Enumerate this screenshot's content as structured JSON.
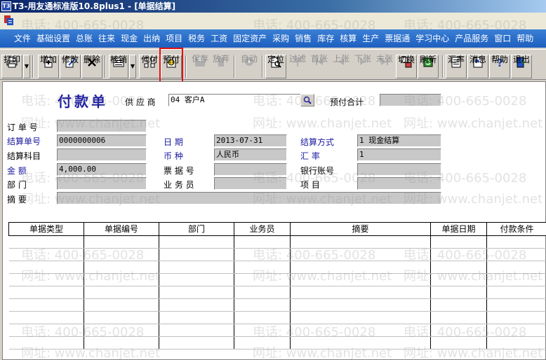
{
  "window": {
    "title": "T3-用友通标准版10.8plus1 - [单据结算]",
    "app_icon": "T3"
  },
  "menu": [
    "文件",
    "基础设置",
    "总账",
    "往来",
    "现金",
    "出纳",
    "项目",
    "税务",
    "工资",
    "固定资产",
    "采购",
    "销售",
    "库存",
    "核算",
    "生产",
    "票据通",
    "学习中心",
    "产品服务",
    "窗口",
    "帮助"
  ],
  "toolbar": {
    "print": "打印",
    "add": "增加",
    "modify": "修改",
    "delete": "删除",
    "writeoff": "核销",
    "proxy_pay": "代付",
    "prepay": "预付",
    "save": "保存",
    "abandon": "放弃",
    "auto": "自动",
    "locate": "定位",
    "filter": "过滤",
    "first": "首张",
    "prev": "上张",
    "next": "下张",
    "last": "末张",
    "switch": "切换",
    "refresh": "刷新",
    "exchange_rate": "汇率",
    "message": "消息",
    "help": "帮助",
    "exit": "退出"
  },
  "form": {
    "title": "付款单",
    "supplier_label": "供 应 商",
    "supplier_value": "04  客户A",
    "prepay_total_label": "预付合计",
    "prepay_total_value": "",
    "order_no_label": "订 单 号",
    "order_no_value": "",
    "settle_no_label": "结算单号",
    "settle_no_value": "0000000006",
    "date_label": "日    期",
    "date_value": "2013-07-31",
    "settle_method_label": "结算方式",
    "settle_method_value": "1  现金结算",
    "settle_subject_label": "结算科目",
    "settle_subject_value": "",
    "currency_label": "币    种",
    "currency_value": "人民币",
    "rate_label": "汇    率",
    "rate_value": "1",
    "amount_label": "金    额",
    "amount_value": "4,000.00",
    "bill_no_label": "票 据 号",
    "bill_no_value": "",
    "bank_account_label": "银行账号",
    "bank_account_value": "",
    "dept_label": "部    门",
    "dept_value": "",
    "salesman_label": "业 务 员",
    "salesman_value": "",
    "project_label": "项    目",
    "project_value": "",
    "summary_label": "摘    要",
    "summary_value": ""
  },
  "grid": {
    "columns": [
      "单据类型",
      "单据编号",
      "部门",
      "业务员",
      "摘要",
      "单据日期",
      "付款条件"
    ],
    "rows": 9
  },
  "watermark": {
    "phone": "电话: 400-665-0028",
    "url": "网址: www.chanjet.net"
  },
  "colors": {
    "menubar": "#1e5fbf",
    "title_blue": "#1a1aa0",
    "highlight": "#e01010"
  }
}
